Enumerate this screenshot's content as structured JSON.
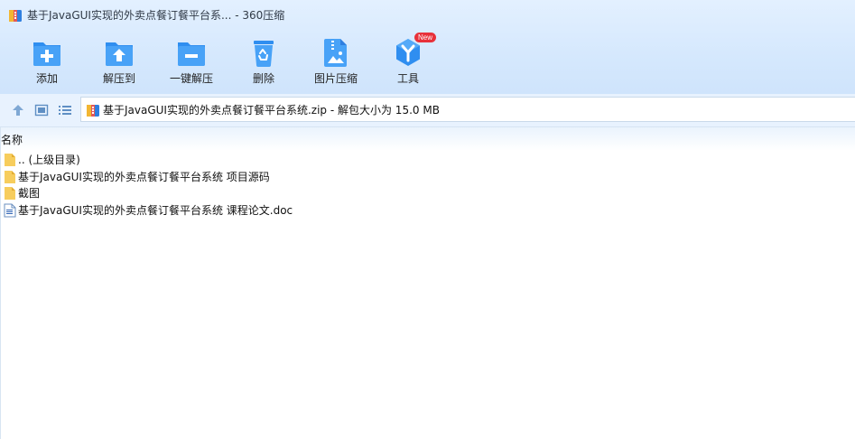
{
  "window": {
    "title": "基于JavaGUI实现的外卖点餐订餐平台系... - 360压缩"
  },
  "toolbar": {
    "items": [
      {
        "label": "添加",
        "icon": "add-folder-icon"
      },
      {
        "label": "解压到",
        "icon": "extract-to-icon"
      },
      {
        "label": "一键解压",
        "icon": "one-click-extract-icon"
      },
      {
        "label": "删除",
        "icon": "recycle-bin-icon"
      },
      {
        "label": "图片压缩",
        "icon": "image-compress-icon"
      },
      {
        "label": "工具",
        "icon": "tools-icon",
        "badge": "New"
      }
    ]
  },
  "nav": {
    "path": "基于JavaGUI实现的外卖点餐订餐平台系统.zip - 解包大小为 15.0 MB"
  },
  "list": {
    "column_name": "名称",
    "rows": [
      {
        "name": ".. (上级目录)",
        "type": "folder"
      },
      {
        "name": "基于JavaGUI实现的外卖点餐订餐平台系统 项目源码",
        "type": "folder"
      },
      {
        "name": "截图",
        "type": "folder"
      },
      {
        "name": "基于JavaGUI实现的外卖点餐订餐平台系统 课程论文.doc",
        "type": "doc"
      }
    ]
  },
  "colors": {
    "accent": "#2f8ef0",
    "chrome": "#d5e8fd",
    "badge": "#e8313a",
    "folder": "#f7cd5d"
  }
}
